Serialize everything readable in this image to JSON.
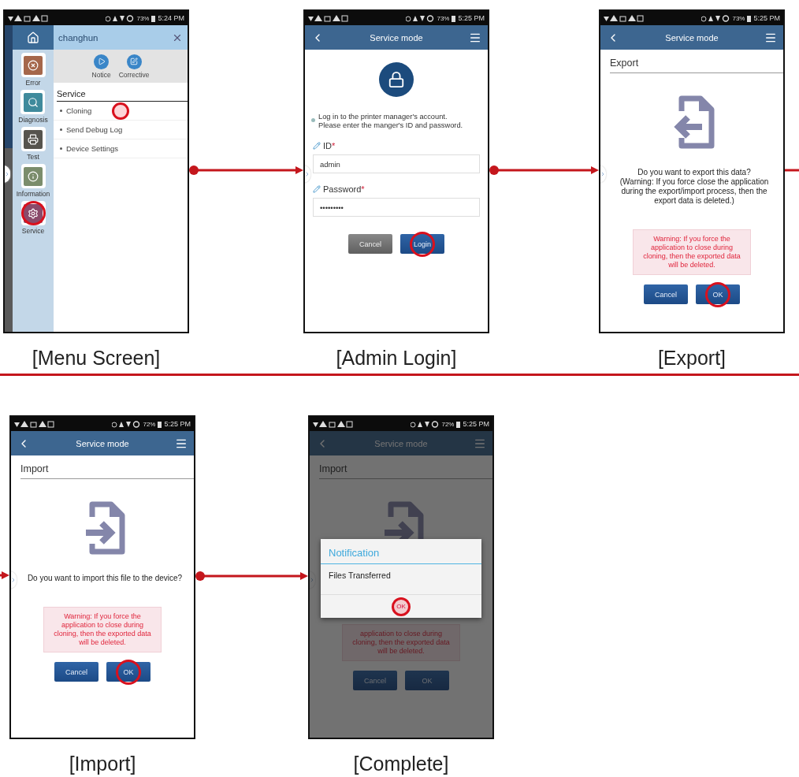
{
  "rows": [
    {
      "screens": [
        {
          "kind": "menu",
          "caption": "[Menu Screen]",
          "status": {
            "battery": "73%",
            "time": "5:24 PM"
          },
          "user": "changhun",
          "quick_actions": [
            "Notice",
            "Corrective"
          ],
          "sidebar": [
            {
              "label": "Error",
              "color": "#a5674b",
              "tapped": false
            },
            {
              "label": "Diagnosis",
              "color": "#3f8a9c",
              "tapped": false
            },
            {
              "label": "Test",
              "color": "#56544e",
              "tapped": false
            },
            {
              "label": "Information",
              "color": "#7b8d6c",
              "tapped": false
            },
            {
              "label": "Service",
              "color": "#8a4a6a",
              "tapped": true
            }
          ],
          "section": "Service",
          "items": [
            {
              "label": "Cloning",
              "tapped": true
            },
            {
              "label": "Send Debug Log",
              "tapped": false
            },
            {
              "label": "Device Settings",
              "tapped": false
            }
          ]
        },
        {
          "kind": "login",
          "caption": "[Admin Login]",
          "status": {
            "battery": "73%",
            "time": "5:25 PM"
          },
          "title": "Service mode",
          "info": "Log in to the printer manager's account.\nPlease enter the manger's ID and password.",
          "fields": [
            {
              "label": "ID",
              "mark": "*",
              "value": "admin"
            },
            {
              "label": "Password",
              "mark": "*",
              "value": "•••••••••"
            }
          ],
          "buttons": [
            {
              "label": "Cancel",
              "kind": "secondary",
              "tapped": false
            },
            {
              "label": "Login",
              "kind": "primary",
              "tapped": true
            }
          ]
        },
        {
          "kind": "export",
          "caption": "[Export]",
          "status": {
            "battery": "73%",
            "time": "5:25 PM"
          },
          "title": "Service mode",
          "heading": "Export",
          "question": "Do you want to export this data?\n(Warning: If you force close the application during the export/import process, then the export data is deleted.)",
          "warning": "Warning: If you force the application to close during cloning, then the exported data will be deleted.",
          "buttons": [
            {
              "label": "Cancel",
              "kind": "primary",
              "tapped": false
            },
            {
              "label": "OK",
              "kind": "primary",
              "tapped": true
            }
          ]
        }
      ]
    },
    {
      "screens": [
        {
          "kind": "import",
          "caption": "[Import]",
          "status": {
            "battery": "72%",
            "time": "5:25 PM"
          },
          "title": "Service mode",
          "heading": "Import",
          "question": "Do you want to import this file to the device?",
          "warning": "Warning: If you force the application to close during cloning, then the exported data will be deleted.",
          "buttons": [
            {
              "label": "Cancel",
              "kind": "primary",
              "tapped": false
            },
            {
              "label": "OK",
              "kind": "primary",
              "tapped": true
            }
          ]
        },
        {
          "kind": "import",
          "caption": "[Complete]",
          "status": {
            "battery": "72%",
            "time": "5:25 PM"
          },
          "title": "Service mode",
          "heading": "Import",
          "warning": "application to close during cloning, then the exported data will be deleted.",
          "buttons": [
            {
              "label": "Cancel",
              "kind": "primary",
              "tapped": false
            },
            {
              "label": "OK",
              "kind": "primary",
              "tapped": false
            }
          ],
          "dialog": {
            "title": "Notification",
            "message": "Files Transferred",
            "button": {
              "label": "OK",
              "tapped": true
            }
          }
        }
      ]
    }
  ]
}
